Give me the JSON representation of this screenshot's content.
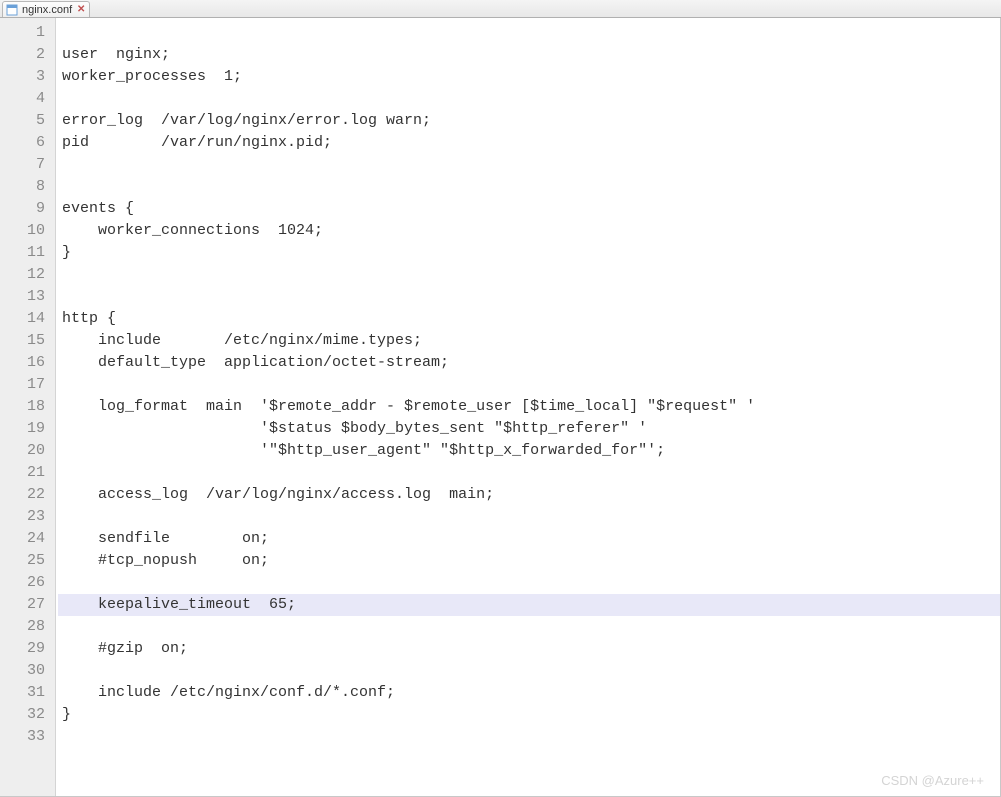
{
  "tab": {
    "filename": "nginx.conf",
    "close_glyph": "✕"
  },
  "editor": {
    "highlighted_line": 27,
    "lines": [
      "",
      "user  nginx;",
      "worker_processes  1;",
      "",
      "error_log  /var/log/nginx/error.log warn;",
      "pid        /var/run/nginx.pid;",
      "",
      "",
      "events {",
      "    worker_connections  1024;",
      "}",
      "",
      "",
      "http {",
      "    include       /etc/nginx/mime.types;",
      "    default_type  application/octet-stream;",
      "",
      "    log_format  main  '$remote_addr - $remote_user [$time_local] \"$request\" '",
      "                      '$status $body_bytes_sent \"$http_referer\" '",
      "                      '\"$http_user_agent\" \"$http_x_forwarded_for\"';",
      "",
      "    access_log  /var/log/nginx/access.log  main;",
      "",
      "    sendfile        on;",
      "    #tcp_nopush     on;",
      "",
      "    keepalive_timeout  65;",
      "",
      "    #gzip  on;",
      "",
      "    include /etc/nginx/conf.d/*.conf;",
      "}",
      ""
    ]
  },
  "watermark": "CSDN @Azure++"
}
